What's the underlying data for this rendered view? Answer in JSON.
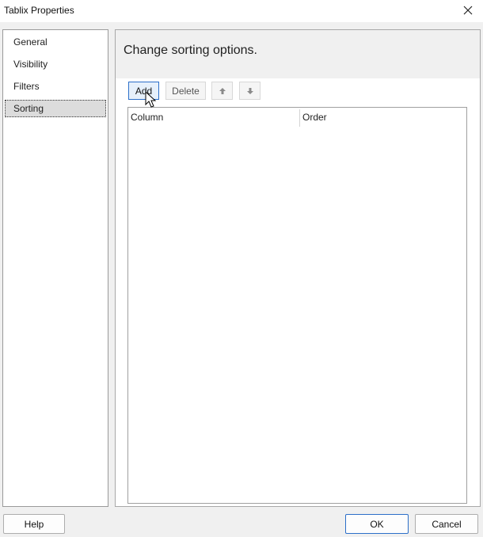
{
  "window": {
    "title": "Tablix Properties",
    "close_icon": "close-icon"
  },
  "nav": {
    "items": [
      {
        "label": "General",
        "selected": false
      },
      {
        "label": "Visibility",
        "selected": false
      },
      {
        "label": "Filters",
        "selected": false
      },
      {
        "label": "Sorting",
        "selected": true
      }
    ]
  },
  "content": {
    "heading": "Change sorting options.",
    "toolbar": {
      "add_label": "Add",
      "delete_label": "Delete",
      "move_up_icon": "arrow-up-icon",
      "move_down_icon": "arrow-down-icon"
    },
    "grid": {
      "columns": [
        "Column",
        "Order"
      ],
      "rows": []
    }
  },
  "footer": {
    "help_label": "Help",
    "ok_label": "OK",
    "cancel_label": "Cancel"
  },
  "colors": {
    "accent": "#2c6fc9",
    "panel_bg": "#f0f0f0",
    "selection_bg": "#dcdcdc"
  }
}
